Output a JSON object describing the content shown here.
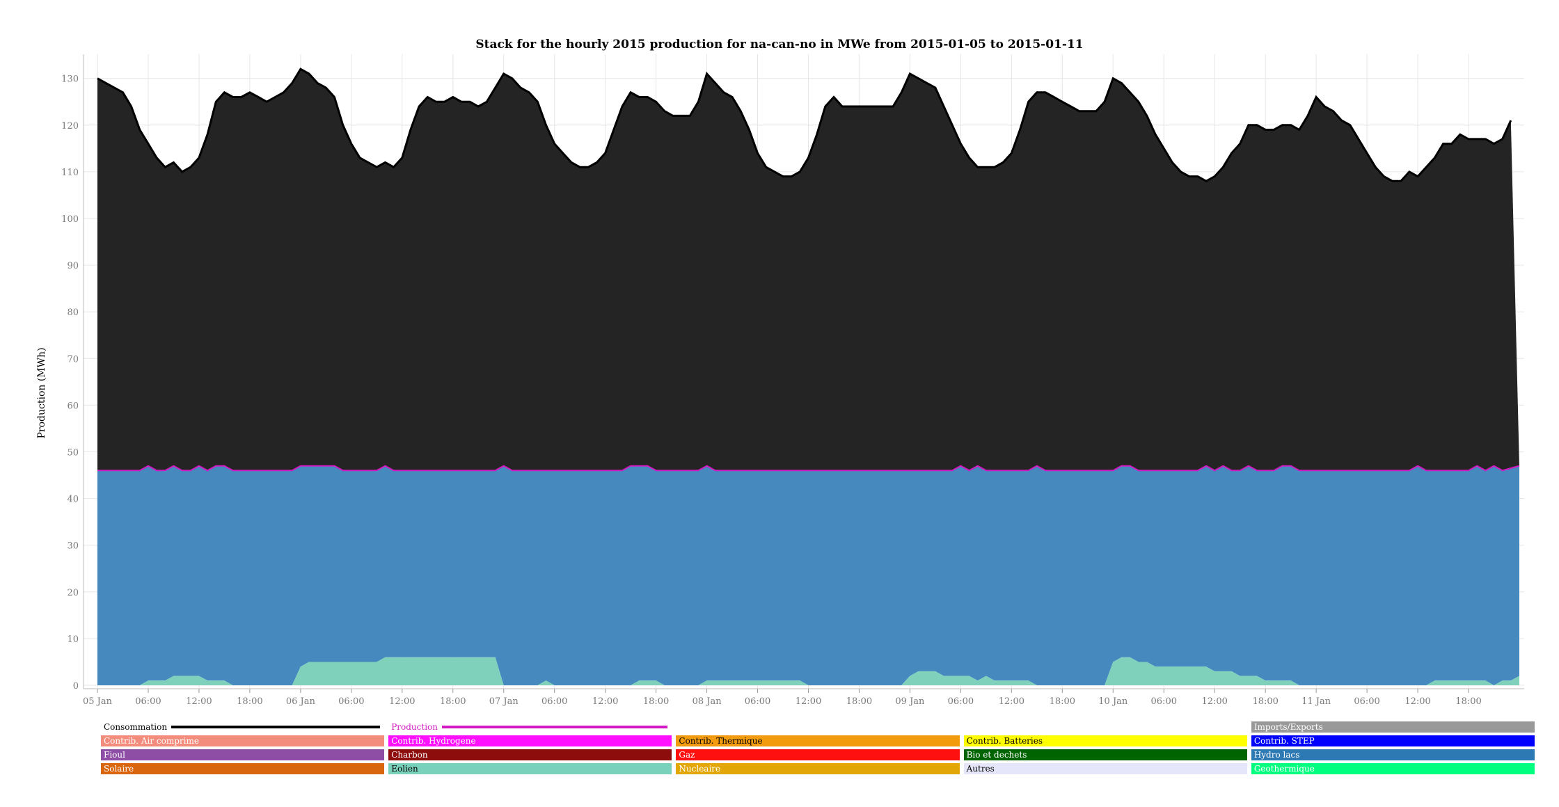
{
  "chart_data": {
    "type": "area",
    "title": "Stack for the hourly 2015 production for na-can-no in MWe from 2015-01-05 to 2015-01-11",
    "ylabel": "Production (MWh)",
    "xlabel": "",
    "ylim": [
      0,
      135
    ],
    "y_ticks": [
      "0",
      "10",
      "20",
      "30",
      "40",
      "50",
      "60",
      "70",
      "80",
      "90",
      "100",
      "110",
      "120",
      "130"
    ],
    "x_tick_labels": [
      "05 Jan",
      "06:00",
      "12:00",
      "18:00",
      "06 Jan",
      "06:00",
      "12:00",
      "18:00",
      "07 Jan",
      "06:00",
      "12:00",
      "18:00",
      "08 Jan",
      "06:00",
      "12:00",
      "18:00",
      "09 Jan",
      "06:00",
      "12:00",
      "18:00",
      "10 Jan",
      "06:00",
      "12:00",
      "18:00",
      "11 Jan",
      "06:00",
      "12:00",
      "18:00"
    ],
    "x_tick_hours": [
      0,
      6,
      12,
      18,
      24,
      30,
      36,
      42,
      48,
      54,
      60,
      66,
      72,
      78,
      84,
      90,
      96,
      102,
      108,
      114,
      120,
      126,
      132,
      138,
      144,
      150,
      156,
      162
    ],
    "x_range_hours": [
      0,
      167
    ],
    "grid": true,
    "colors": {
      "eolien": "#7fd1bc",
      "hydro": "#4689be",
      "production_line": "#d319c1",
      "imports": "#242424",
      "consumption_line": "#000000"
    },
    "series": [
      {
        "name": "Eolien",
        "key": "eolien",
        "color": "#7fd1bc",
        "points": [
          [
            0,
            0
          ],
          [
            5,
            0
          ],
          [
            6,
            1
          ],
          [
            8,
            1
          ],
          [
            9,
            2
          ],
          [
            12,
            2
          ],
          [
            13,
            1
          ],
          [
            15,
            1
          ],
          [
            16,
            0
          ],
          [
            23,
            0
          ],
          [
            24,
            4
          ],
          [
            25,
            5
          ],
          [
            33,
            5
          ],
          [
            34,
            6
          ],
          [
            47,
            6
          ],
          [
            48,
            0
          ],
          [
            52,
            0
          ],
          [
            53,
            1
          ],
          [
            54,
            0
          ],
          [
            63,
            0
          ],
          [
            64,
            1
          ],
          [
            66,
            1
          ],
          [
            67,
            0
          ],
          [
            71,
            0
          ],
          [
            72,
            1
          ],
          [
            83,
            1
          ],
          [
            84,
            0
          ],
          [
            95,
            0
          ],
          [
            96,
            2
          ],
          [
            97,
            3
          ],
          [
            99,
            3
          ],
          [
            100,
            2
          ],
          [
            103,
            2
          ],
          [
            104,
            1
          ],
          [
            105,
            2
          ],
          [
            106,
            1
          ],
          [
            110,
            1
          ],
          [
            111,
            0
          ],
          [
            119,
            0
          ],
          [
            120,
            5
          ],
          [
            121,
            6
          ],
          [
            122,
            6
          ],
          [
            123,
            5
          ],
          [
            124,
            5
          ],
          [
            125,
            4
          ],
          [
            131,
            4
          ],
          [
            132,
            3
          ],
          [
            134,
            3
          ],
          [
            135,
            2
          ],
          [
            137,
            2
          ],
          [
            138,
            1
          ],
          [
            141,
            1
          ],
          [
            142,
            0
          ],
          [
            157,
            0
          ],
          [
            158,
            1
          ],
          [
            164,
            1
          ],
          [
            165,
            0
          ],
          [
            166,
            1
          ],
          [
            167,
            1
          ],
          [
            168,
            2
          ]
        ]
      },
      {
        "name": "Hydro lacs",
        "key": "hydro",
        "color": "#4689be",
        "points_total": [
          [
            0,
            46
          ],
          [
            5,
            46
          ],
          [
            6,
            47
          ],
          [
            7,
            46
          ],
          [
            8,
            46
          ],
          [
            9,
            47
          ],
          [
            10,
            46
          ],
          [
            11,
            46
          ],
          [
            12,
            47
          ],
          [
            13,
            46
          ],
          [
            14,
            47
          ],
          [
            15,
            47
          ],
          [
            16,
            46
          ],
          [
            23,
            46
          ],
          [
            24,
            47
          ],
          [
            28,
            47
          ],
          [
            29,
            46
          ],
          [
            33,
            46
          ],
          [
            34,
            47
          ],
          [
            35,
            46
          ],
          [
            47,
            46
          ],
          [
            48,
            47
          ],
          [
            49,
            46
          ],
          [
            62,
            46
          ],
          [
            63,
            47
          ],
          [
            65,
            47
          ],
          [
            66,
            46
          ],
          [
            71,
            46
          ],
          [
            72,
            47
          ],
          [
            73,
            46
          ],
          [
            84,
            46
          ],
          [
            85,
            46
          ],
          [
            101,
            46
          ],
          [
            102,
            47
          ],
          [
            103,
            46
          ],
          [
            104,
            47
          ],
          [
            105,
            46
          ],
          [
            110,
            46
          ],
          [
            111,
            47
          ],
          [
            112,
            46
          ],
          [
            120,
            46
          ],
          [
            121,
            47
          ],
          [
            122,
            47
          ],
          [
            123,
            46
          ],
          [
            130,
            46
          ],
          [
            131,
            47
          ],
          [
            132,
            46
          ],
          [
            133,
            47
          ],
          [
            134,
            46
          ],
          [
            135,
            46
          ],
          [
            136,
            47
          ],
          [
            137,
            46
          ],
          [
            139,
            46
          ],
          [
            140,
            47
          ],
          [
            141,
            47
          ],
          [
            142,
            46
          ],
          [
            155,
            46
          ],
          [
            156,
            47
          ],
          [
            157,
            46
          ],
          [
            162,
            46
          ],
          [
            163,
            47
          ],
          [
            164,
            46
          ],
          [
            165,
            47
          ],
          [
            166,
            46
          ],
          [
            168,
            47
          ]
        ]
      },
      {
        "name": "Imports/Exports",
        "key": "imports",
        "color": "#242424",
        "points_total": [
          [
            0,
            130
          ],
          [
            1,
            129
          ],
          [
            2,
            128
          ],
          [
            3,
            127
          ],
          [
            4,
            124
          ],
          [
            5,
            119
          ],
          [
            6,
            116
          ],
          [
            7,
            113
          ],
          [
            8,
            111
          ],
          [
            9,
            112
          ],
          [
            10,
            110
          ],
          [
            11,
            111
          ],
          [
            12,
            113
          ],
          [
            13,
            118
          ],
          [
            14,
            125
          ],
          [
            15,
            127
          ],
          [
            16,
            126
          ],
          [
            17,
            126
          ],
          [
            18,
            127
          ],
          [
            19,
            126
          ],
          [
            20,
            125
          ],
          [
            21,
            126
          ],
          [
            22,
            127
          ],
          [
            23,
            129
          ],
          [
            24,
            132
          ],
          [
            25,
            131
          ],
          [
            26,
            129
          ],
          [
            27,
            128
          ],
          [
            28,
            126
          ],
          [
            29,
            120
          ],
          [
            30,
            116
          ],
          [
            31,
            113
          ],
          [
            32,
            112
          ],
          [
            33,
            111
          ],
          [
            34,
            112
          ],
          [
            35,
            111
          ],
          [
            36,
            113
          ],
          [
            37,
            119
          ],
          [
            38,
            124
          ],
          [
            39,
            126
          ],
          [
            40,
            125
          ],
          [
            41,
            125
          ],
          [
            42,
            126
          ],
          [
            43,
            125
          ],
          [
            44,
            125
          ],
          [
            45,
            124
          ],
          [
            46,
            125
          ],
          [
            47,
            128
          ],
          [
            48,
            131
          ],
          [
            49,
            130
          ],
          [
            50,
            128
          ],
          [
            51,
            127
          ],
          [
            52,
            125
          ],
          [
            53,
            120
          ],
          [
            54,
            116
          ],
          [
            55,
            114
          ],
          [
            56,
            112
          ],
          [
            57,
            111
          ],
          [
            58,
            111
          ],
          [
            59,
            112
          ],
          [
            60,
            114
          ],
          [
            61,
            119
          ],
          [
            62,
            124
          ],
          [
            63,
            127
          ],
          [
            64,
            126
          ],
          [
            65,
            126
          ],
          [
            66,
            125
          ],
          [
            67,
            123
          ],
          [
            68,
            122
          ],
          [
            69,
            122
          ],
          [
            70,
            122
          ],
          [
            71,
            125
          ],
          [
            72,
            131
          ],
          [
            73,
            129
          ],
          [
            74,
            127
          ],
          [
            75,
            126
          ],
          [
            76,
            123
          ],
          [
            77,
            119
          ],
          [
            78,
            114
          ],
          [
            79,
            111
          ],
          [
            80,
            110
          ],
          [
            81,
            109
          ],
          [
            82,
            109
          ],
          [
            83,
            110
          ],
          [
            84,
            113
          ],
          [
            85,
            118
          ],
          [
            86,
            124
          ],
          [
            87,
            126
          ],
          [
            88,
            124
          ],
          [
            89,
            124
          ],
          [
            90,
            124
          ],
          [
            91,
            124
          ],
          [
            92,
            124
          ],
          [
            93,
            124
          ],
          [
            94,
            124
          ],
          [
            95,
            127
          ],
          [
            96,
            131
          ],
          [
            97,
            130
          ],
          [
            98,
            129
          ],
          [
            99,
            128
          ],
          [
            100,
            124
          ],
          [
            101,
            120
          ],
          [
            102,
            116
          ],
          [
            103,
            113
          ],
          [
            104,
            111
          ],
          [
            105,
            111
          ],
          [
            106,
            111
          ],
          [
            107,
            112
          ],
          [
            108,
            114
          ],
          [
            109,
            119
          ],
          [
            110,
            125
          ],
          [
            111,
            127
          ],
          [
            112,
            127
          ],
          [
            113,
            126
          ],
          [
            114,
            125
          ],
          [
            115,
            124
          ],
          [
            116,
            123
          ],
          [
            117,
            123
          ],
          [
            118,
            123
          ],
          [
            119,
            125
          ],
          [
            120,
            130
          ],
          [
            121,
            129
          ],
          [
            122,
            127
          ],
          [
            123,
            125
          ],
          [
            124,
            122
          ],
          [
            125,
            118
          ],
          [
            126,
            115
          ],
          [
            127,
            112
          ],
          [
            128,
            110
          ],
          [
            129,
            109
          ],
          [
            130,
            109
          ],
          [
            131,
            108
          ],
          [
            132,
            109
          ],
          [
            133,
            111
          ],
          [
            134,
            114
          ],
          [
            135,
            116
          ],
          [
            136,
            120
          ],
          [
            137,
            120
          ],
          [
            138,
            119
          ],
          [
            139,
            119
          ],
          [
            140,
            120
          ],
          [
            141,
            120
          ],
          [
            142,
            119
          ],
          [
            143,
            122
          ],
          [
            144,
            126
          ],
          [
            145,
            124
          ],
          [
            146,
            123
          ],
          [
            147,
            121
          ],
          [
            148,
            120
          ],
          [
            149,
            117
          ],
          [
            150,
            114
          ],
          [
            151,
            111
          ],
          [
            152,
            109
          ],
          [
            153,
            108
          ],
          [
            154,
            108
          ],
          [
            155,
            110
          ],
          [
            156,
            109
          ],
          [
            157,
            111
          ],
          [
            158,
            113
          ],
          [
            159,
            116
          ],
          [
            160,
            116
          ],
          [
            161,
            118
          ],
          [
            162,
            117
          ],
          [
            163,
            117
          ],
          [
            164,
            117
          ],
          [
            165,
            116
          ],
          [
            166,
            117
          ],
          [
            167,
            121
          ]
        ]
      }
    ],
    "legend": [
      [
        "Consommation",
        "Production",
        "",
        "",
        "Imports/Exports"
      ],
      [
        "Contrib. Air comprime",
        "Contrib. Hydrogene",
        "Contrib. Thermique",
        "Contrib. Batteries",
        "Contrib. STEP"
      ],
      [
        "Fioul",
        "Charbon",
        "Gaz",
        "Bio et dechets",
        "Hydro lacs"
      ],
      [
        "Solaire",
        "Eolien",
        "Nucleaire",
        "Autres",
        "Geothermique"
      ]
    ],
    "legend_colors": [
      [
        "#000000",
        "#d319c1",
        "",
        "",
        "#999999"
      ],
      [
        "#f48c7e",
        "#ff10ff",
        "#f29b0f",
        "#ffff00",
        "#0000ff"
      ],
      [
        "#8e4ea6",
        "#8d0c0c",
        "#ff1010",
        "#006400",
        "#2d79b3"
      ],
      [
        "#d9650c",
        "#79d0bb",
        "#e2a707",
        "#e6e6fa",
        "#00ff7f"
      ]
    ],
    "legend_text_colors": [
      [
        "#000000",
        "#d319c1",
        "",
        "",
        "#ffffff"
      ],
      [
        "#ffffff",
        "#ffffff",
        "#000000",
        "#000000",
        "#ffffff"
      ],
      [
        "#ffffff",
        "#ffffff",
        "#ffffff",
        "#ffffff",
        "#ffffff"
      ],
      [
        "#ffffff",
        "#000000",
        "#ffffff",
        "#000000",
        "#ffffff"
      ]
    ]
  }
}
